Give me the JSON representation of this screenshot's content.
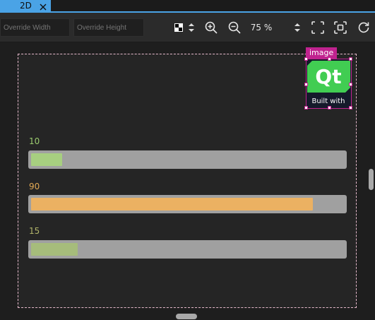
{
  "tab": {
    "label": "2D",
    "active_color": "#4aa3e6"
  },
  "toolbar": {
    "override_width_placeholder": "Override Width",
    "override_height_placeholder": "Override Height",
    "zoom_level": "75 %"
  },
  "canvas": {
    "selection": {
      "label": "image",
      "color": "#c0238f"
    },
    "logo": {
      "mark": "Qt",
      "caption": "Built with"
    },
    "sliders": [
      {
        "value_label": "10",
        "value": 10,
        "max": 100,
        "label_color": "#9acb6e",
        "fill_color": "#a7cf80"
      },
      {
        "value_label": "90",
        "value": 90,
        "max": 100,
        "label_color": "#e2a954",
        "fill_color": "#ebb162"
      },
      {
        "value_label": "15",
        "value": 15,
        "max": 100,
        "label_color": "#b1b46a",
        "fill_color": "#a6bc7b"
      }
    ]
  }
}
